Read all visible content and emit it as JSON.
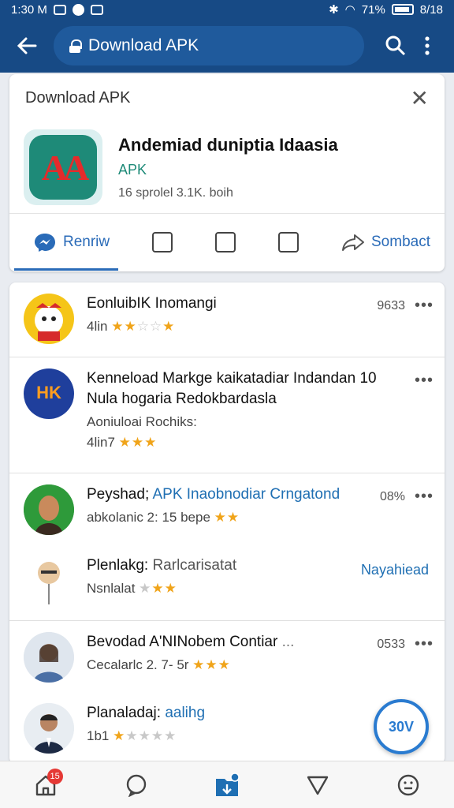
{
  "status_bar": {
    "time": "1:30 M",
    "battery": "71%",
    "extra": "8/18"
  },
  "app_bar": {
    "url_label": "Download APK",
    "accent": "#174a85"
  },
  "download_card": {
    "header": "Download APK",
    "app_name": "Andemiad duniptia Idaasia",
    "app_type": "APK",
    "app_info": "16 sprolel 3.1K. boih",
    "actions": {
      "review": "Renriw",
      "contact": "Sombact"
    }
  },
  "items": [
    {
      "title": "EonluibIK Inomangi",
      "sub": "4lin",
      "stars_on": "★★",
      "stars_off": "☆☆",
      "star_end": "★",
      "count": "9633",
      "more": "•••"
    },
    {
      "title": "Kenneload Markge kaikatadiar Indandan 10 Nula hogaria Redokbardasla",
      "sub": "Aoniuloai Rochiks:",
      "sub2": "4lin7",
      "stars": "★★★",
      "more": "•••"
    },
    {
      "title_a": "Peyshad;",
      "title_b": "APK Inaobnodiar Crngatond",
      "sub": "abkolanic 2: 15 bepe",
      "stars": "★★",
      "count": "08%",
      "more": "•••"
    },
    {
      "title_a": "Plenlakg:",
      "title_b": "Rarlcarisatat",
      "sub": "Nsnlalat",
      "stars_off": "★",
      "stars": "★★",
      "link": "Nayahiead"
    },
    {
      "title": "Bevodad A'NINobem Contiar",
      "ellipsis": "...",
      "sub": "Cecalarlc 2. 7- 5r",
      "stars": "★★★",
      "count": "0533",
      "more": "•••"
    },
    {
      "title_a": "Planaladaj:",
      "title_b": "aalihg",
      "sub": "1b1",
      "stars_on": "★",
      "stars_off": "★★★★"
    }
  ],
  "fab": {
    "label": "30V"
  },
  "bottom_nav": {
    "badge": "15"
  }
}
